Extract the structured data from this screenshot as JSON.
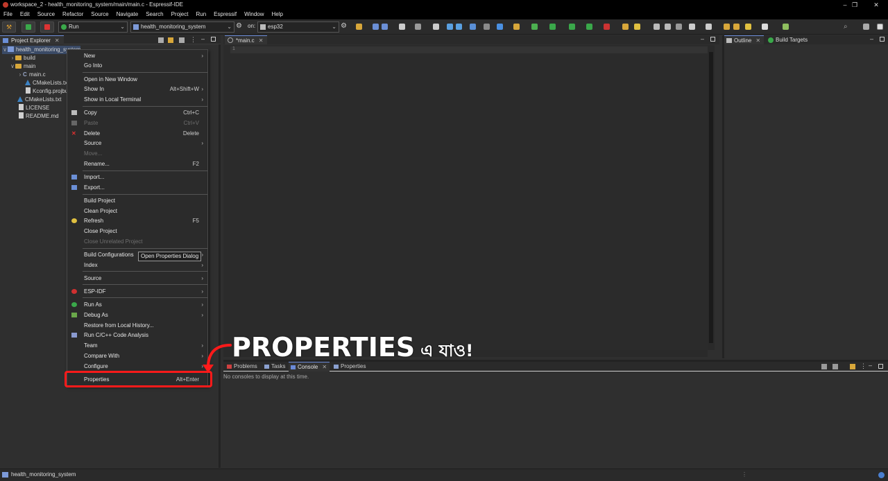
{
  "window": {
    "title": "workspace_2 - health_monitoring_system/main/main.c - Espressif-IDE",
    "controls": [
      "–",
      "❐",
      "✕"
    ]
  },
  "menubar": [
    "File",
    "Edit",
    "Source",
    "Refactor",
    "Source",
    "Navigate",
    "Search",
    "Project",
    "Run",
    "Espressif",
    "Window",
    "Help"
  ],
  "toolbar": {
    "launch_mode": "Run",
    "launch_config": "health_monitoring_system",
    "on_label": "on:",
    "target": "esp32"
  },
  "project_explorer": {
    "tab_label": "Project Explorer",
    "tree": [
      {
        "label": "health_monitoring_system",
        "twisty": "∨",
        "icon": "project-icon"
      },
      {
        "label": "build",
        "twisty": "›",
        "icon": "folder-icon"
      },
      {
        "label": "main",
        "twisty": "∨",
        "icon": "folder-icon"
      },
      {
        "label": "main.c",
        "twisty": "›",
        "icon": "c-file-icon"
      },
      {
        "label": "CMakeLists.txt",
        "twisty": "",
        "icon": "cmake-icon"
      },
      {
        "label": "Kconfig.projbuild",
        "twisty": "",
        "icon": "file-icon"
      },
      {
        "label": "CMakeLists.txt",
        "twisty": "",
        "icon": "cmake-icon"
      },
      {
        "label": "LICENSE",
        "twisty": "",
        "icon": "file-icon"
      },
      {
        "label": "README.md",
        "twisty": "",
        "icon": "file-icon"
      }
    ]
  },
  "editor": {
    "tab_label": "*main.c",
    "line_number": "1"
  },
  "outline": {
    "tabs": [
      "Outline",
      "Build Targets"
    ]
  },
  "console": {
    "tabs": [
      "Problems",
      "Tasks",
      "Console",
      "Properties"
    ],
    "message": "No consoles to display at this time."
  },
  "context_menu": {
    "items": [
      {
        "label": "New",
        "shortcut": "",
        "submenu": true,
        "disabled": false
      },
      {
        "label": "Go Into",
        "shortcut": "",
        "submenu": false,
        "disabled": false
      },
      {
        "label": "Open in New Window",
        "shortcut": "",
        "submenu": false,
        "disabled": false
      },
      {
        "label": "Show In",
        "shortcut": "Alt+Shift+W",
        "submenu": true,
        "disabled": false
      },
      {
        "label": "Show in Local Terminal",
        "shortcut": "",
        "submenu": true,
        "disabled": false
      },
      {
        "label": "Copy",
        "shortcut": "Ctrl+C",
        "submenu": false,
        "disabled": false
      },
      {
        "label": "Paste",
        "shortcut": "Ctrl+V",
        "submenu": false,
        "disabled": true
      },
      {
        "label": "Delete",
        "shortcut": "Delete",
        "submenu": false,
        "disabled": false
      },
      {
        "label": "Source",
        "shortcut": "",
        "submenu": true,
        "disabled": false
      },
      {
        "label": "Move...",
        "shortcut": "",
        "submenu": false,
        "disabled": true
      },
      {
        "label": "Rename...",
        "shortcut": "F2",
        "submenu": false,
        "disabled": false
      },
      {
        "label": "Import...",
        "shortcut": "",
        "submenu": false,
        "disabled": false
      },
      {
        "label": "Export...",
        "shortcut": "",
        "submenu": false,
        "disabled": false
      },
      {
        "label": "Build Project",
        "shortcut": "",
        "submenu": false,
        "disabled": false
      },
      {
        "label": "Clean Project",
        "shortcut": "",
        "submenu": false,
        "disabled": false
      },
      {
        "label": "Refresh",
        "shortcut": "F5",
        "submenu": false,
        "disabled": false
      },
      {
        "label": "Close Project",
        "shortcut": "",
        "submenu": false,
        "disabled": false
      },
      {
        "label": "Close Unrelated Project",
        "shortcut": "",
        "submenu": false,
        "disabled": true
      },
      {
        "label": "Build Configurations",
        "shortcut": "",
        "submenu": true,
        "disabled": false
      },
      {
        "label": "Index",
        "shortcut": "",
        "submenu": true,
        "disabled": false
      },
      {
        "label": "Source",
        "shortcut": "",
        "submenu": true,
        "disabled": false
      },
      {
        "label": "ESP-IDF",
        "shortcut": "",
        "submenu": true,
        "disabled": false
      },
      {
        "label": "Run As",
        "shortcut": "",
        "submenu": true,
        "disabled": false
      },
      {
        "label": "Debug As",
        "shortcut": "",
        "submenu": true,
        "disabled": false
      },
      {
        "label": "Restore from Local History...",
        "shortcut": "",
        "submenu": false,
        "disabled": false
      },
      {
        "label": "Run C/C++ Code Analysis",
        "shortcut": "",
        "submenu": false,
        "disabled": false
      },
      {
        "label": "Team",
        "shortcut": "",
        "submenu": true,
        "disabled": false
      },
      {
        "label": "Compare With",
        "shortcut": "",
        "submenu": true,
        "disabled": false
      },
      {
        "label": "Configure",
        "shortcut": "",
        "submenu": true,
        "disabled": false
      },
      {
        "label": "Properties",
        "shortcut": "Alt+Enter",
        "submenu": false,
        "disabled": false
      }
    ],
    "tooltip": "Open Properties Dialog"
  },
  "annotation": {
    "main": "PROPERTIES",
    "sub": "এ যাও!",
    "color": "#ff1a1a"
  },
  "statusbar": {
    "text": "health_monitoring_system"
  }
}
